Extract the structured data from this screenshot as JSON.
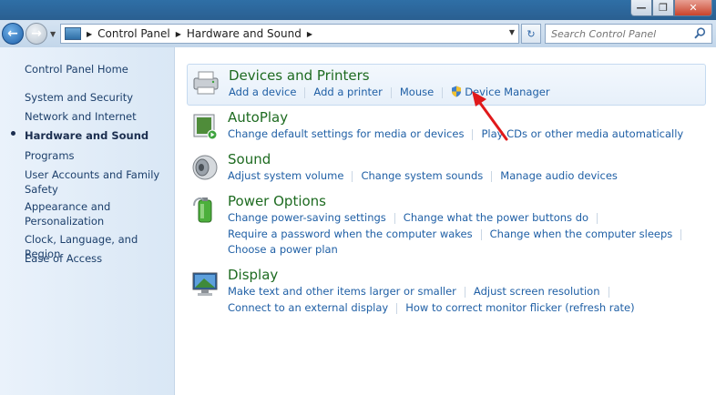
{
  "window": {
    "minimize": "—",
    "maximize": "❐",
    "close": "✕"
  },
  "address": {
    "crumbs": [
      "Control Panel",
      "Hardware and Sound"
    ]
  },
  "search": {
    "placeholder": "Search Control Panel"
  },
  "sidebar": {
    "items": [
      {
        "label": "Control Panel Home"
      },
      {
        "label": "System and Security"
      },
      {
        "label": "Network and Internet"
      },
      {
        "label": "Hardware and Sound",
        "active": true
      },
      {
        "label": "Programs"
      },
      {
        "label": "User Accounts and Family Safety"
      },
      {
        "label": "Appearance and Personalization"
      },
      {
        "label": "Clock, Language, and Region"
      },
      {
        "label": "Ease of Access"
      }
    ]
  },
  "categories": [
    {
      "title": "Devices and Printers",
      "icon": "printer-icon",
      "links": [
        "Add a device",
        "Add a printer",
        "Mouse",
        "Device Manager"
      ]
    },
    {
      "title": "AutoPlay",
      "icon": "autoplay-icon",
      "links": [
        "Change default settings for media or devices",
        "Play CDs or other media automatically"
      ]
    },
    {
      "title": "Sound",
      "icon": "speaker-icon",
      "links": [
        "Adjust system volume",
        "Change system sounds",
        "Manage audio devices"
      ]
    },
    {
      "title": "Power Options",
      "icon": "battery-icon",
      "links": [
        "Change power-saving settings",
        "Change what the power buttons do",
        "Require a password when the computer wakes",
        "Change when the computer sleeps",
        "Choose a power plan"
      ]
    },
    {
      "title": "Display",
      "icon": "monitor-icon",
      "links": [
        "Make text and other items larger or smaller",
        "Adjust screen resolution",
        "Connect to an external display",
        "How to correct monitor flicker (refresh rate)"
      ]
    }
  ],
  "colors": {
    "accent_link": "#1f5fa5",
    "category_title": "#1e6b21",
    "annotation_arrow": "#e0191b"
  }
}
